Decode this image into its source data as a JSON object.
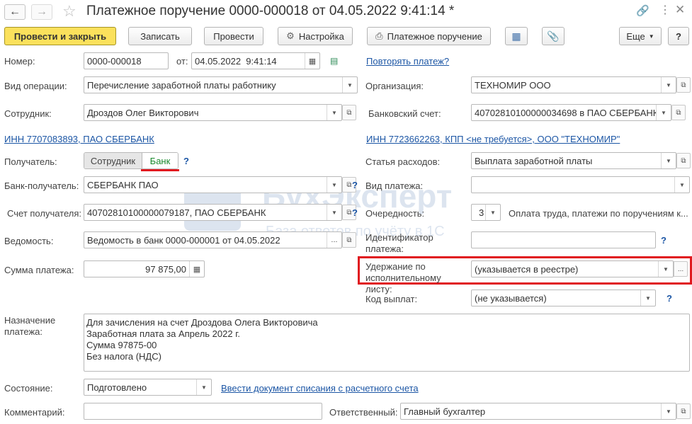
{
  "window": {
    "title": "Платежное поручение 0000-000018 от 04.05.2022 9:41:14 *"
  },
  "toolbar": {
    "post_close": "Провести и закрыть",
    "save": "Записать",
    "post": "Провести",
    "settings": "Настройка",
    "print_order": "Платежное поручение",
    "more": "Еще",
    "help": "?"
  },
  "form": {
    "number_label": "Номер:",
    "number": "0000-000018",
    "date_label": "от:",
    "date": "04.05.2022  9:41:14",
    "repeat_link": "Повторять платеж?",
    "op_label": "Вид операции:",
    "op": "Перечисление заработной платы работнику",
    "org_label": "Организация:",
    "org": "ТЕХНОМИР ООО",
    "emp_label": "Сотрудник:",
    "emp": "Дроздов Олег Викторович",
    "bank_acc_label": "Банковский счет:",
    "bank_acc": "40702810100000034698 в ПАО СБЕРБАНК",
    "inn_left": "ИНН 7707083893, ПАО СБЕРБАНК",
    "inn_right": "ИНН 7723662263, КПП <не требуется>, ООО \"ТЕХНОМИР\"",
    "recipient_label": "Получатель:",
    "toggle_employee": "Сотрудник",
    "toggle_bank": "Банк",
    "expense_label": "Статья расходов:",
    "expense": "Выплата заработной платы",
    "recv_bank_label": "Банк-получатель:",
    "recv_bank": "СБЕРБАНК ПАО",
    "pay_kind_label": "Вид платежа:",
    "pay_kind": "",
    "recv_acc_label": "Счет получателя:",
    "recv_acc": "40702810100000079187, ПАО СБЕРБАНК",
    "priority_label": "Очередность:",
    "priority": "3",
    "priority_desc": "Оплата труда, платежи по поручениям к...",
    "statement_label": "Ведомость:",
    "statement": "Ведомость в банк 0000-000001 от 04.05.2022",
    "payment_id_label": "Идентификатор платежа:",
    "payment_id": "",
    "sum_label": "Сумма платежа:",
    "sum": "97 875,00",
    "withhold_label": "Удержание по исполнительному листу:",
    "withhold": "(указывается в реестре)",
    "pay_code_label": "Код выплат:",
    "pay_code": "(не указывается)",
    "purpose_label": "Назначение платежа:",
    "purpose_lines": [
      "Для зачисления на счет Дроздова Олега Викторовича",
      "Заработная плата за Апрель 2022 г.",
      "Сумма 97875-00",
      "Без налога (НДС)"
    ],
    "state_label": "Состояние:",
    "state": "Подготовлено",
    "writeoff_link": "Ввести документ списания с расчетного счета",
    "comment_label": "Комментарий:",
    "comment": "",
    "responsible_label": "Ответственный:",
    "responsible": "Главный бухгалтер"
  },
  "watermark": {
    "title": "БухЭксперт",
    "subtitle": "База ответов по учёту в 1С"
  },
  "colors": {
    "primary": "#fbe15c",
    "link": "#1c56a5",
    "highlight": "#e0191f",
    "bank_toggle": "#1a8a2e"
  }
}
